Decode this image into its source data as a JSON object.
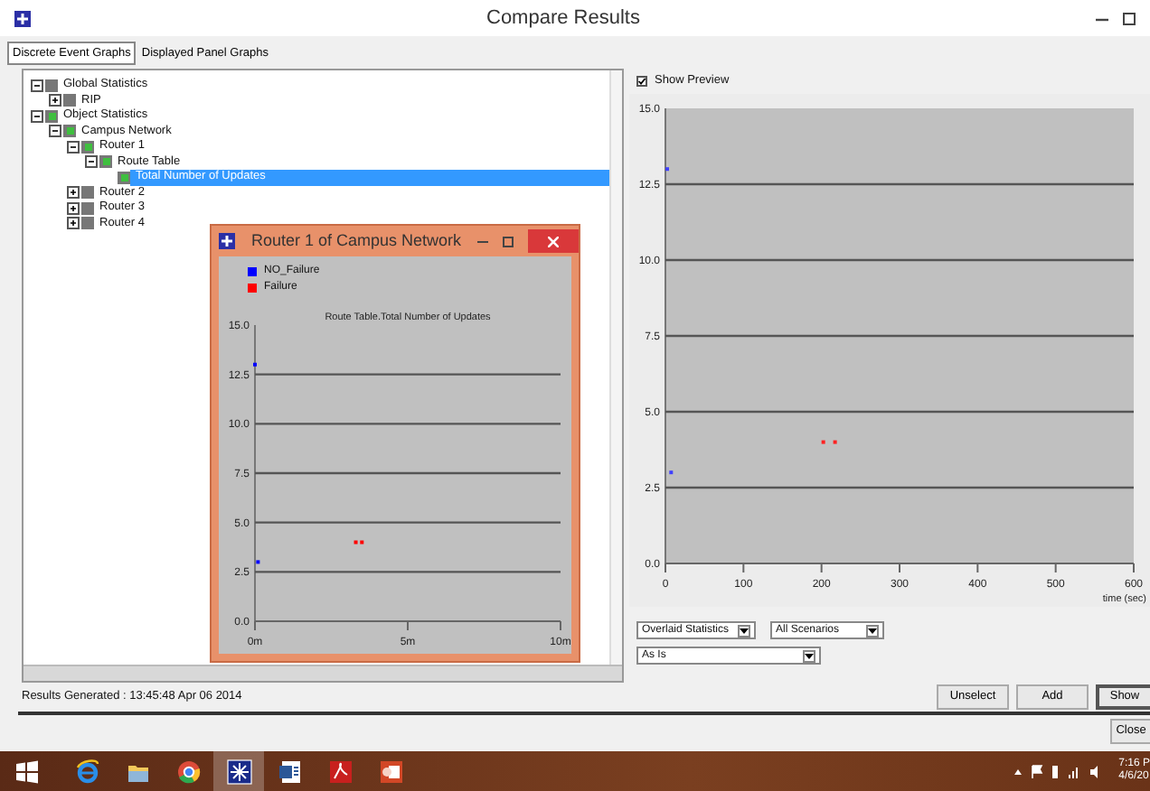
{
  "window": {
    "title": "Compare Results"
  },
  "tabs": [
    {
      "label": "Discrete Event Graphs",
      "selected": true
    },
    {
      "label": "Displayed Panel Graphs",
      "selected": false
    }
  ],
  "tree": [
    {
      "label": "Global Statistics",
      "expanded": true,
      "marked": false,
      "selected": false,
      "children": [
        {
          "label": "RIP",
          "expanded": false,
          "marked": false,
          "selected": false
        }
      ]
    },
    {
      "label": "Object Statistics",
      "expanded": true,
      "marked": true,
      "selected": false,
      "children": [
        {
          "label": "Campus Network",
          "expanded": true,
          "marked": true,
          "selected": false,
          "children": [
            {
              "label": "Router 1",
              "expanded": true,
              "marked": true,
              "selected": false,
              "children": [
                {
                  "label": "Route Table",
                  "expanded": true,
                  "marked": true,
                  "selected": false,
                  "children": [
                    {
                      "label": "Total Number of Updates",
                      "marked": true,
                      "selected": true
                    }
                  ]
                }
              ]
            },
            {
              "label": "Router 2",
              "expanded": false,
              "marked": false,
              "selected": false
            },
            {
              "label": "Router 3",
              "expanded": false,
              "marked": false,
              "selected": false
            },
            {
              "label": "Router 4",
              "expanded": false,
              "marked": false,
              "selected": false
            }
          ]
        }
      ]
    }
  ],
  "preview": {
    "label": "Show Preview",
    "checked": true,
    "chart_data": {
      "type": "scatter",
      "xlabel": "time (sec)",
      "x": [
        0,
        5,
        200,
        215
      ],
      "xlim": [
        0,
        600
      ],
      "ylim": [
        0,
        15
      ],
      "grid": true,
      "xticks": [
        0,
        100,
        200,
        300,
        400,
        500,
        600
      ],
      "yticks": [
        {
          "value": 0,
          "label": "0.0"
        },
        {
          "value": 2.5,
          "label": "2.5"
        },
        {
          "value": 5,
          "label": "5.0"
        },
        {
          "value": 7.5,
          "label": "7.5"
        },
        {
          "value": 10,
          "label": "10.0"
        },
        {
          "value": 12.5,
          "label": "12.5"
        },
        {
          "value": 15,
          "label": "15.0"
        }
      ],
      "series": [
        {
          "color": "#4040ff",
          "values": [
            13,
            3,
            null,
            null
          ]
        },
        {
          "color": "#ff2020",
          "values": [
            null,
            null,
            4,
            4
          ]
        }
      ]
    }
  },
  "dropdowns": [
    {
      "value": "Overlaid Statistics"
    },
    {
      "value": "All Scenarios"
    },
    {
      "value": "As Is"
    }
  ],
  "status": "Results Generated : 13:45:48 Apr 06 2014",
  "buttons": [
    {
      "label": "Unselect",
      "default": false
    },
    {
      "label": "Add",
      "default": false
    },
    {
      "label": "Show",
      "default": true
    }
  ],
  "close_button": "Close",
  "popup": {
    "title": "Router 1 of Campus Network",
    "chart_data": {
      "type": "scatter",
      "title": "Route Table.Total Number of Updates",
      "x": [
        0,
        0.1,
        3.3,
        3.5
      ],
      "xlim": [
        0,
        10
      ],
      "ylim": [
        0,
        15
      ],
      "grid": true,
      "xticks": [
        {
          "value": 0,
          "label": "0m"
        },
        {
          "value": 5,
          "label": "5m"
        },
        {
          "value": 10,
          "label": "10m"
        }
      ],
      "yticks": [
        {
          "value": 0,
          "label": "0.0"
        },
        {
          "value": 2.5,
          "label": "2.5"
        },
        {
          "value": 5,
          "label": "5.0"
        },
        {
          "value": 7.5,
          "label": "7.5"
        },
        {
          "value": 10,
          "label": "10.0"
        },
        {
          "value": 12.5,
          "label": "12.5"
        },
        {
          "value": 15,
          "label": "15.0"
        }
      ],
      "series": [
        {
          "name": "NO_Failure",
          "color": "#0000ff",
          "values": [
            13,
            3,
            null,
            null
          ]
        },
        {
          "name": "Failure",
          "color": "#ff0000",
          "values": [
            null,
            null,
            4,
            4
          ]
        }
      ]
    }
  },
  "taskbar": {
    "apps": [
      {
        "kind": "start",
        "selected": false
      },
      {
        "kind": "browser",
        "selected": false
      },
      {
        "kind": "folder",
        "selected": false
      },
      {
        "kind": "chrome",
        "selected": false
      },
      {
        "kind": "star",
        "selected": true
      },
      {
        "kind": "word",
        "selected": false
      },
      {
        "kind": "pdf",
        "selected": false
      },
      {
        "kind": "slides",
        "selected": false
      }
    ],
    "time": "7:16 P",
    "date": "4/6/20"
  }
}
